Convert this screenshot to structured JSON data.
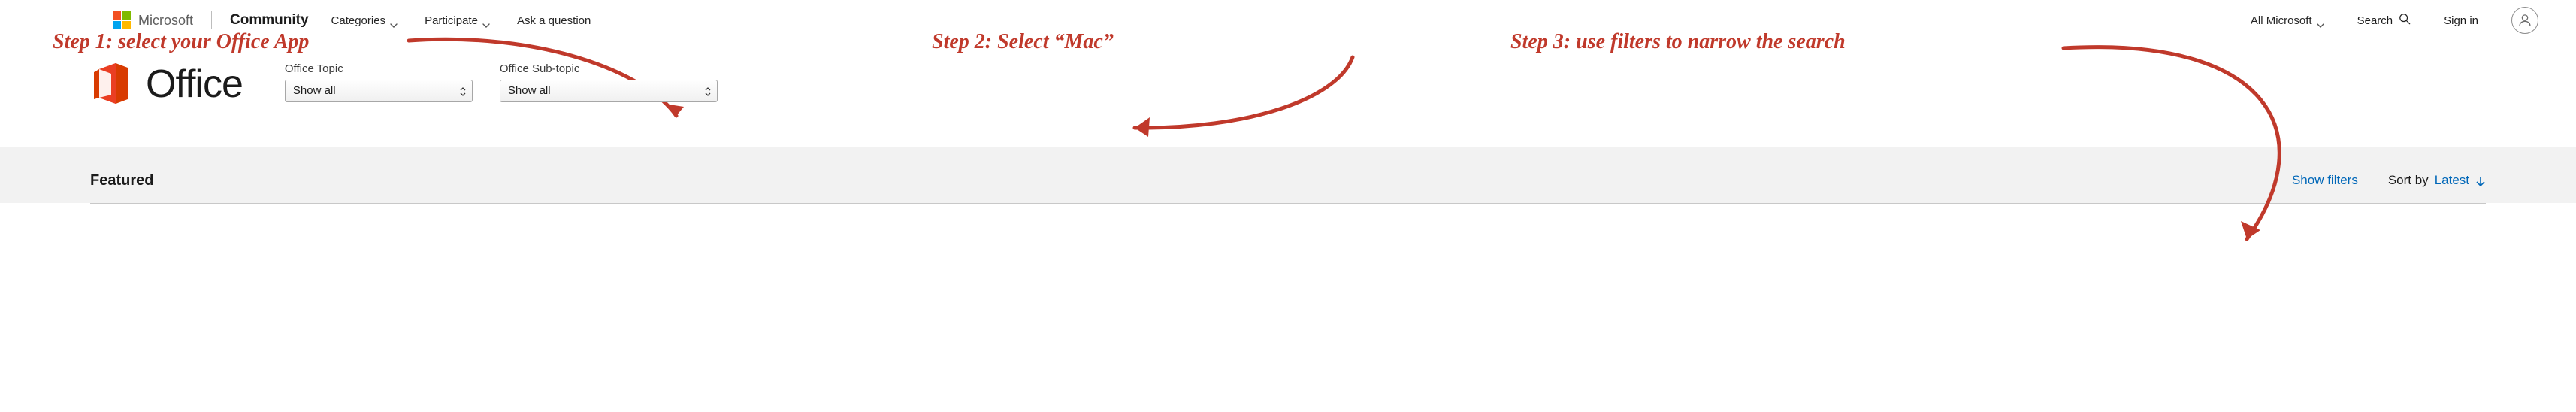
{
  "topnav": {
    "brand": "Microsoft",
    "community": "Community",
    "categories": "Categories",
    "participate": "Participate",
    "ask_question": "Ask a question",
    "all_microsoft": "All Microsoft",
    "search": "Search",
    "sign_in": "Sign in"
  },
  "annotations": {
    "step1": "Step 1: select your Office App",
    "step2": "Step 2: Select “Mac”",
    "step3": "Step 3: use filters to narrow the search"
  },
  "office": {
    "title": "Office",
    "topic_label": "Office Topic",
    "subtopic_label": "Office Sub-topic",
    "topic_value": "Show all",
    "subtopic_value": "Show all"
  },
  "featured": {
    "heading": "Featured",
    "show_filters": "Show filters",
    "sort_by_label": "Sort by",
    "sort_by_value": "Latest"
  },
  "colors": {
    "annotation": "#c0392b",
    "link_blue": "#0067b8",
    "office_orange": "#d83b01"
  }
}
